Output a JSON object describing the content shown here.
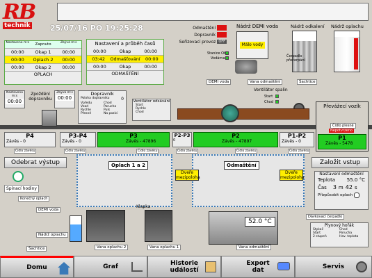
{
  "header": {
    "logo_main": "RB",
    "logo_sub": "technik",
    "datetime": "25/07/16 PO 19:25:28"
  },
  "alarms": {
    "items": [
      {
        "label": "Odmaštění",
        "state": "red"
      },
      {
        "label": "Dopravník",
        "state": "red"
      },
      {
        "label": "Seřizovací provoz",
        "value": "OFF"
      }
    ]
  },
  "tanks_top": {
    "demi_title": "Nádrž DEMI voda",
    "malo_vody": "Málo vody",
    "stanice_ok": "Stanice OK",
    "vodarna": "Vodárna",
    "demi_label": "DEMI voda",
    "odkaleni_title": "Nádrž odkalení",
    "opl_title": "Nádrž oplachu",
    "cerpadlo": "Čerpadlo přečerpání",
    "sachtice": "Šachtice",
    "vana_odm": "Vana odmaštění",
    "ventilator_spalin": "Ventilátor spalin",
    "start": "Start",
    "chod": "Chod"
  },
  "panel_left": {
    "headers": [
      "Nastaveno\nm:s",
      "Zapnuto",
      "Zbývá\nm:s"
    ],
    "rows": [
      {
        "a": "00:00",
        "b": "Okap 1",
        "c": "00:00",
        "hl": false
      },
      {
        "a": "00:00",
        "b": "Oplach 2",
        "c": "00:00",
        "hl": true
      },
      {
        "a": "00:00",
        "b": "Okap 2",
        "c": "00:00",
        "hl": false
      }
    ],
    "footer": "OPLACH"
  },
  "panel_mid": {
    "title": "Nastavení a průběh časů",
    "rows": [
      {
        "a": "00:00",
        "b": "Okap",
        "c": "00:00",
        "hl": false
      },
      {
        "a": "03:42",
        "b": "Odmašťování",
        "c": "00:00",
        "hl": true
      },
      {
        "a": "00:00",
        "b": "Okap",
        "c": "00:00",
        "hl": false
      }
    ],
    "footer": "ODMAŠTĚNÍ"
  },
  "dopravnik": {
    "title": "Dopravník",
    "poloha_label": "Poloha dopravníku",
    "poloha": "0",
    "items": [
      "Vpředu",
      "Vzad",
      "Rychle",
      "Přesně"
    ],
    "right_items": [
      "Chod",
      "Porucha",
      "Puls",
      "Na pozici"
    ],
    "nast_label": "Nastaveno m:s",
    "nast": "00:00",
    "zpozdeni_label": "Zpoždění dopravníku",
    "zbyva_label": "Zbývá m:s",
    "zbyva": "00:00"
  },
  "ventilator": {
    "title": "Ventilátor odsávání",
    "items": [
      "Start",
      "Rychle",
      "Chod",
      "Porucha"
    ]
  },
  "stations": [
    {
      "name": "P4",
      "zaves": "0",
      "cidlo": "Čidlo závěsu"
    },
    {
      "name": "P3-P4",
      "zaves": "0",
      "cidlo": "Čidlo závěsu"
    },
    {
      "name": "P3",
      "zaves": "47896",
      "cidlo": "Čidlo závěsu",
      "green": true
    },
    {
      "name": "P2-P3",
      "zaves": "0",
      "cidlo": "Čidlo závěsu"
    },
    {
      "name": "P2",
      "zaves": "47897",
      "cidlo": "Čidlo závěsu",
      "green": true
    },
    {
      "name": "P1-P2",
      "zaves": "0",
      "cidlo": "Čidlo závěsu"
    },
    {
      "name": "P1",
      "zaves": "5478",
      "cidlo": "Čidlo závěsu",
      "green": true
    }
  ],
  "zaves_label": "Závěs -",
  "prevazeci": {
    "title": "Převážecí vozík",
    "cidlo_plesne": "Čidlo plesné",
    "nepotvrzeno": "Nepotvrzeno"
  },
  "odebrat": "Odebrat výstup",
  "zalozit": "Založit vstup",
  "spinaci": "Spínací hodiny",
  "labels": {
    "oplach12": "Oplach 1 a 2",
    "odmasteni": "Odmaštění",
    "dvere1": "Dveře mezipoloha",
    "dvere2": "Dveře mezipoloha",
    "klapka": "Klapka",
    "konecny": "Konečný oplach",
    "demi2": "DEMI voda",
    "nadrz_opl": "Nádrž oplachu",
    "sachtice2": "Šachtice",
    "vana_opl2": "Vana oplachu 2",
    "vana_opl1": "Vana oplachu 1",
    "vana_odm2": "Vana odmaštění",
    "temp": "52.0 °C"
  },
  "nastaveni_odm": {
    "title": "Nastavení odmaštění",
    "teplota_label": "Teplota",
    "teplota": "55.0 °C",
    "cas_label": "Čas",
    "cas_m": "3",
    "m": "m",
    "cas_s": "42",
    "s": "s",
    "prizpusobit": "Přizpůsobit oplach"
  },
  "davkovaci": "Dávkovací čerpadlo",
  "horak": {
    "title": "Plynový hořák",
    "items": [
      "Stykač",
      "Start",
      "2 stupeň"
    ],
    "right": [
      "Chod",
      "Porucha",
      "Hav. teplota"
    ]
  },
  "nav": [
    {
      "label": "Domu",
      "icon": "home-icon"
    },
    {
      "label": "Graf",
      "icon": "chart-icon"
    },
    {
      "label": "Historie událostí",
      "icon": "history-icon"
    },
    {
      "label": "Export dat",
      "icon": "export-icon"
    },
    {
      "label": "Servis",
      "icon": "wrench-icon"
    }
  ]
}
